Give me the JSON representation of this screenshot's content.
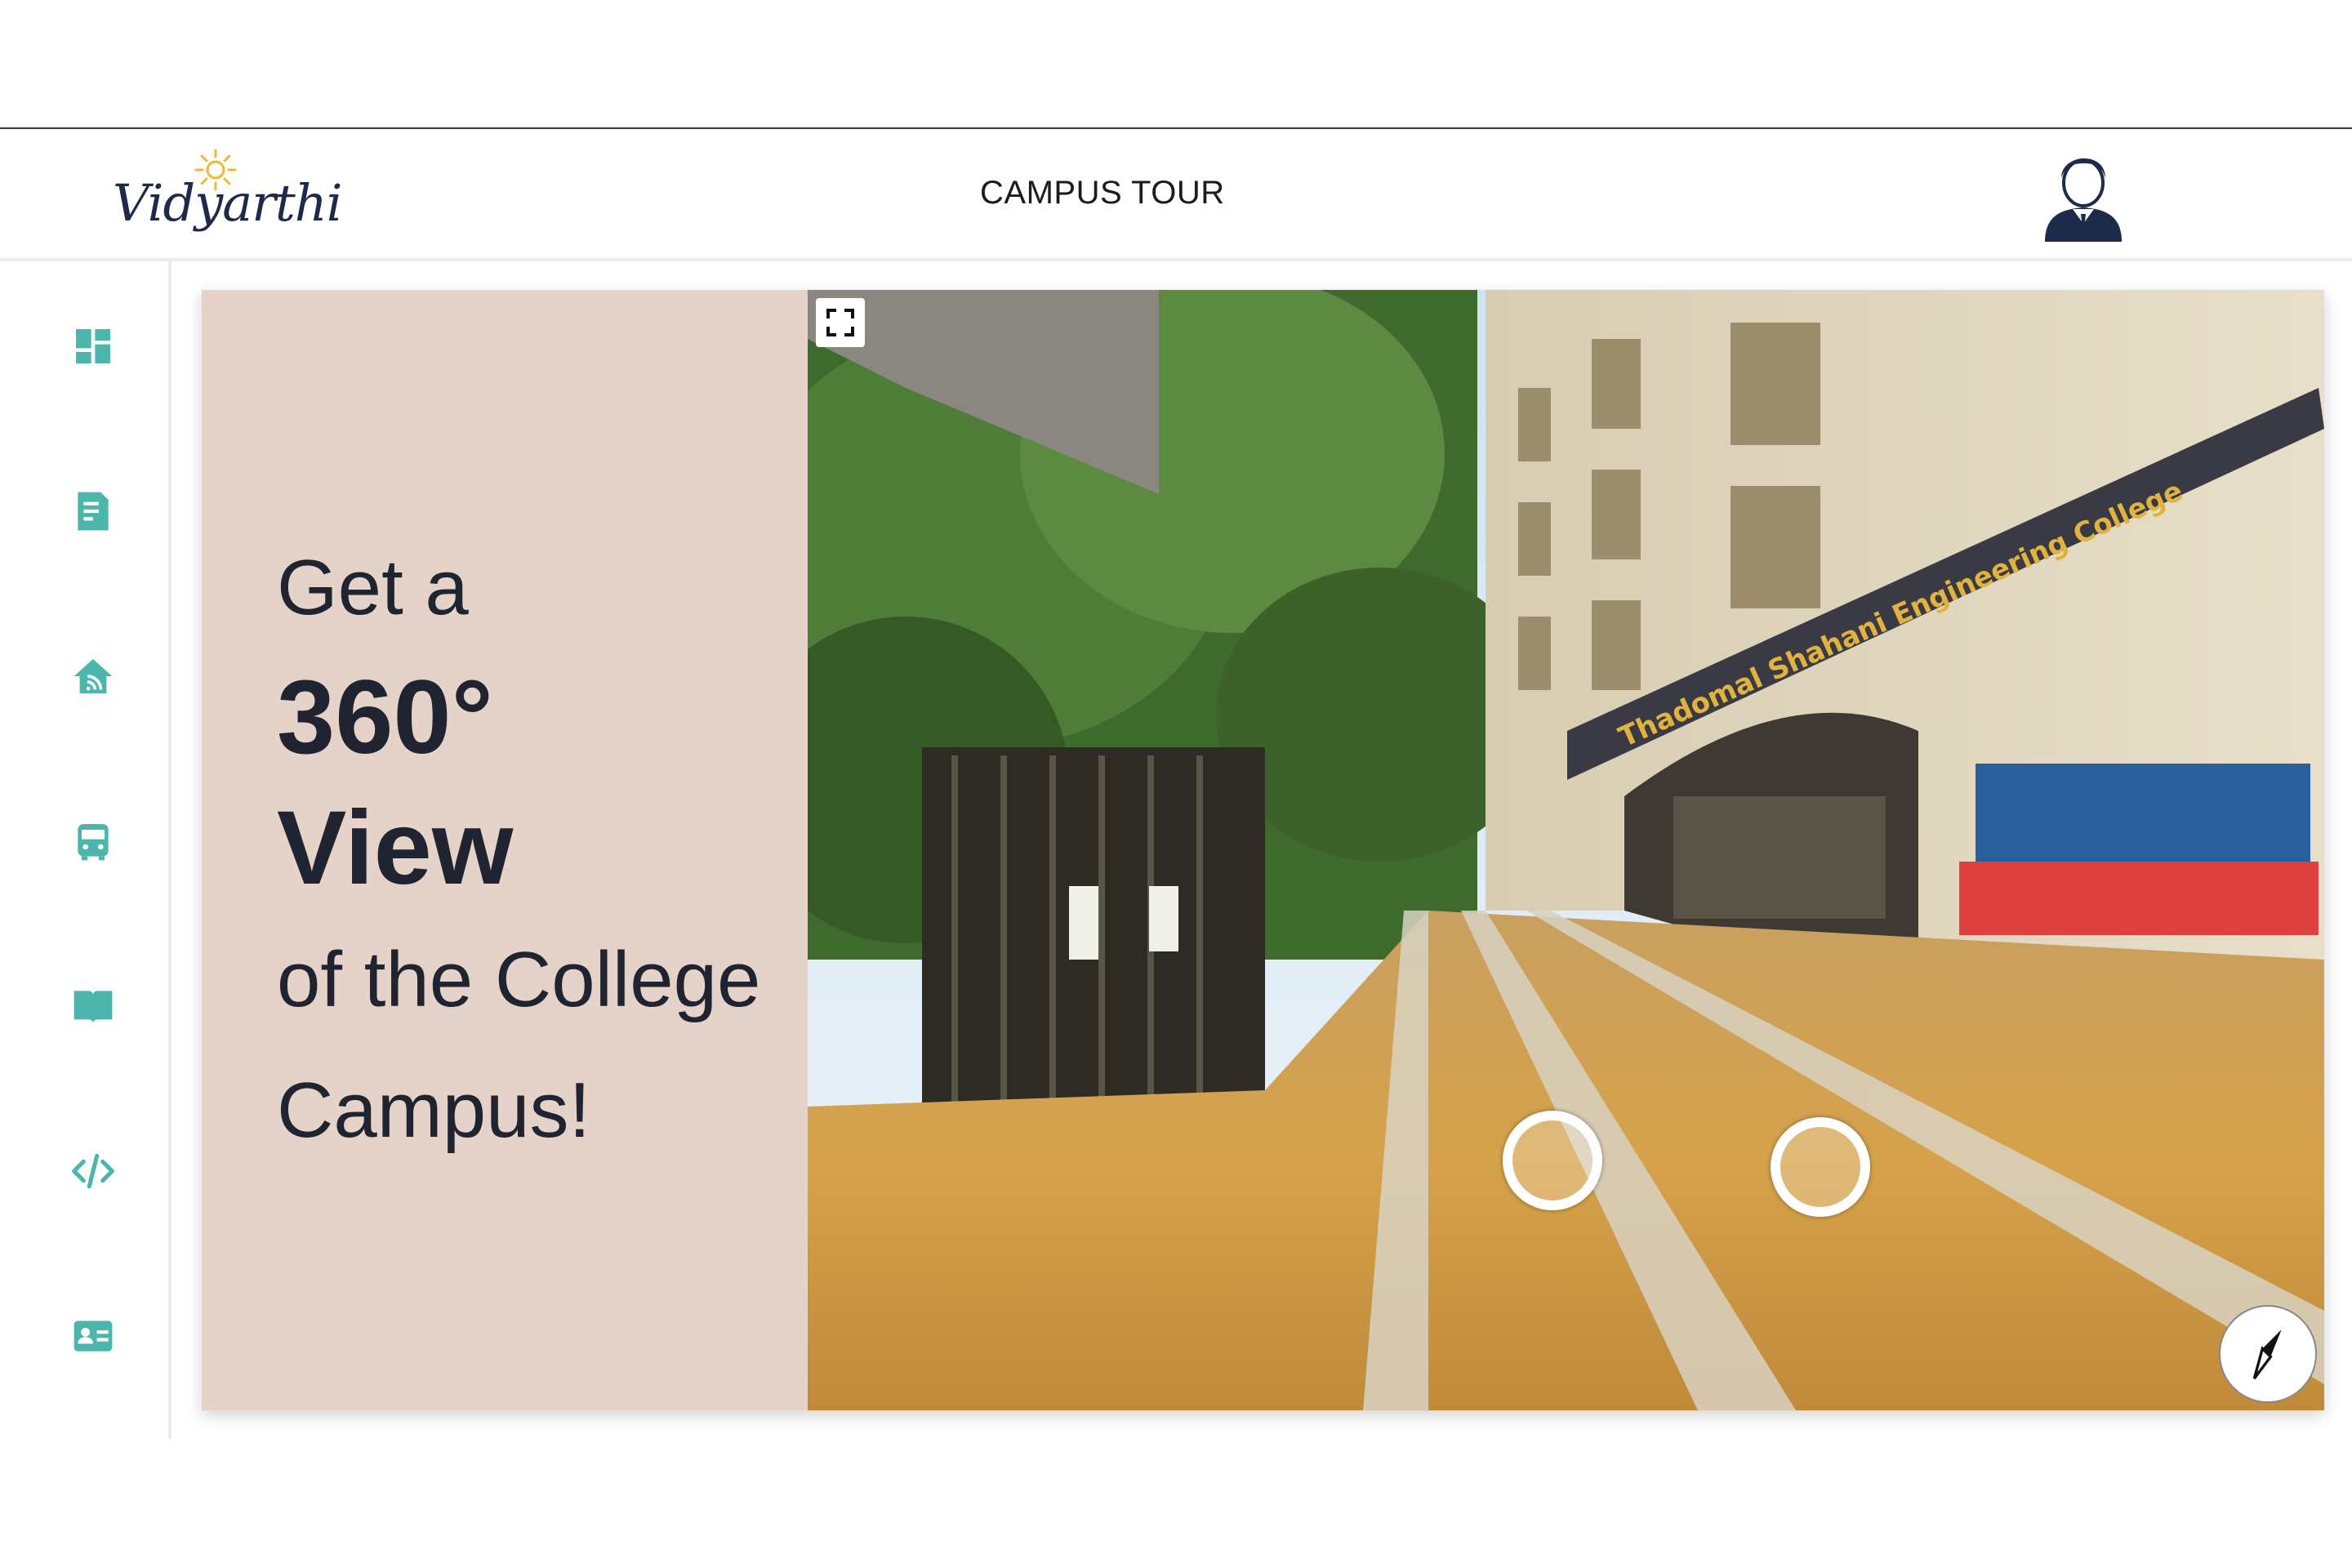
{
  "header": {
    "logo_text": "Vidyarthi",
    "title": "CAMPUS TOUR"
  },
  "sidebar": {
    "items": [
      {
        "icon": "dashboard-icon"
      },
      {
        "icon": "notes-icon"
      },
      {
        "icon": "home-icon"
      },
      {
        "icon": "bus-icon"
      },
      {
        "icon": "book-icon"
      },
      {
        "icon": "code-icon"
      },
      {
        "icon": "id-card-icon"
      }
    ]
  },
  "promo": {
    "line1": "Get a",
    "line2": "360°",
    "line3": "View",
    "line4": "of the College",
    "line5": "Campus!"
  },
  "panorama": {
    "building_sign": "Thadomal Shahani Engineering College"
  },
  "colors": {
    "accent": "#4db6ac",
    "promo_bg": "#e5d3ca",
    "text_dark": "#1f2430"
  }
}
